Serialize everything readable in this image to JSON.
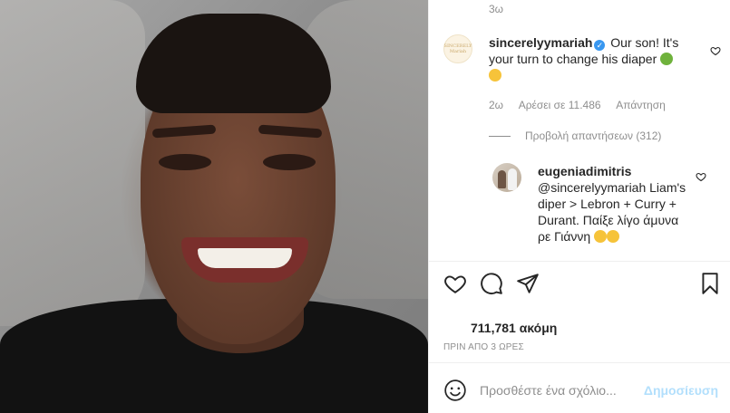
{
  "photo": {
    "alt": ""
  },
  "comments_panel": {
    "top_time": "3ω",
    "comments": [
      {
        "username": "sincerelyymariah",
        "verified": true,
        "text_part1": "Our son! It's your turn to change his diaper",
        "time": "2ω",
        "likes": "Αρέσει σε 11.486",
        "reply": "Απάντηση",
        "avatar_text": "SINCERELY Mariah",
        "emoji": [
          "sick-face-emoji",
          "laughing-tears-emoji"
        ]
      },
      {
        "username": "eugeniadimitris",
        "text": "@sincerelyymariah Liam's diper > Lebron + Curry + Durant. Παίξε λίγο άμυνα ρε Γιάννη",
        "emoji": [
          "laughing-tears-emoji",
          "laughing-tears-emoji"
        ]
      }
    ],
    "view_replies": "Προβολή απαντήσεων (312)"
  },
  "actions": {
    "icons": [
      "heart-icon",
      "comment-icon",
      "share-icon",
      "bookmark-icon"
    ]
  },
  "likes_count": "711,781 ακόμη",
  "posted_ago": "ΠΡΙΝ ΑΠΟ 3 ΩΡΕΣ",
  "add_comment": {
    "placeholder": "Προσθέστε ένα σχόλιο...",
    "post_label": "Δημοσίευση"
  },
  "colors": {
    "link_blue": "#3897f0",
    "post_disabled": "#b2dffc",
    "muted_text": "#8e8e8e",
    "primary_text": "#262626"
  }
}
